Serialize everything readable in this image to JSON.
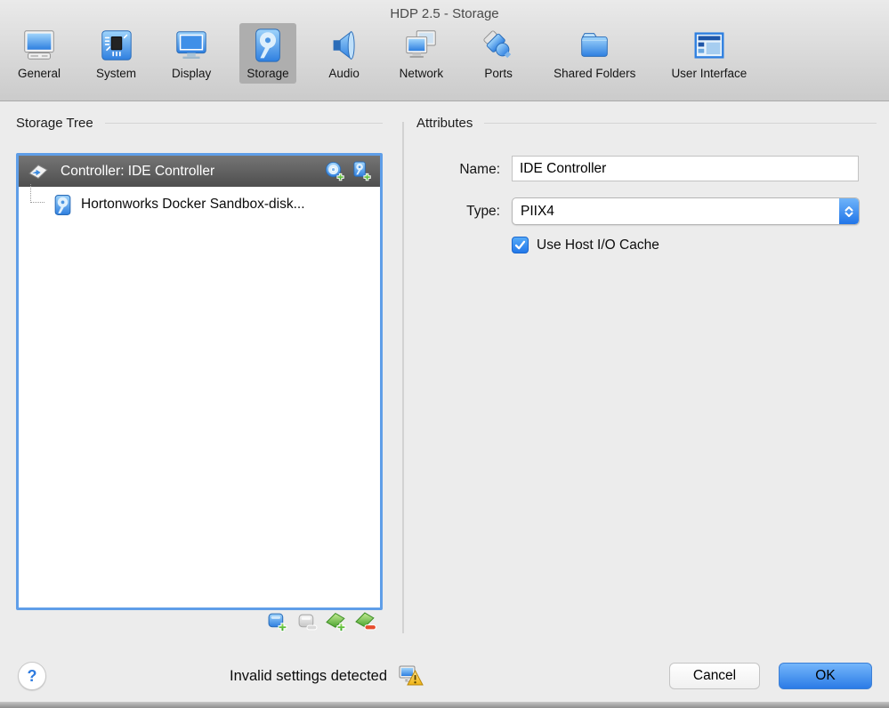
{
  "window": {
    "title": "HDP 2.5 - Storage"
  },
  "toolbar": {
    "items": [
      {
        "label": "General",
        "icon": "general-icon",
        "selected": false
      },
      {
        "label": "System",
        "icon": "system-icon",
        "selected": false
      },
      {
        "label": "Display",
        "icon": "display-icon",
        "selected": false
      },
      {
        "label": "Storage",
        "icon": "storage-icon",
        "selected": true
      },
      {
        "label": "Audio",
        "icon": "audio-icon",
        "selected": false
      },
      {
        "label": "Network",
        "icon": "network-icon",
        "selected": false
      },
      {
        "label": "Ports",
        "icon": "ports-icon",
        "selected": false
      },
      {
        "label": "Shared Folders",
        "icon": "shared-folders-icon",
        "selected": false
      },
      {
        "label": "User Interface",
        "icon": "user-interface-icon",
        "selected": false
      }
    ]
  },
  "storage_tree": {
    "section_label": "Storage Tree",
    "controller": {
      "label": "Controller: IDE Controller",
      "action_icons": [
        "add-optical-drive-icon",
        "add-hard-disk-icon"
      ]
    },
    "attachments": [
      {
        "label": "Hortonworks Docker Sandbox-disk...",
        "icon": "hard-disk-icon"
      }
    ],
    "footer_action_icons": [
      "add-controller-icon",
      "remove-controller-icon",
      "add-attachment-icon",
      "remove-attachment-icon"
    ]
  },
  "attributes": {
    "section_label": "Attributes",
    "name_label": "Name:",
    "name_value": "IDE Controller",
    "type_label": "Type:",
    "type_value": "PIIX4",
    "checkbox_label": "Use Host I/O Cache",
    "checkbox_checked": true
  },
  "footer": {
    "help_label": "?",
    "status_text": "Invalid settings detected",
    "status_icon": "invalid-settings-warning-icon",
    "cancel_label": "Cancel",
    "ok_label": "OK"
  },
  "colors": {
    "accent_blue": "#2b7be6",
    "tree_focus_border": "#5f9ee8",
    "controller_row_bg": "#4e4e4e",
    "selected_toolbar_bg": "#aeaeae",
    "warning_yellow": "#f5b916",
    "add_green": "#2f9e1f",
    "remove_red": "#e64d2e"
  }
}
